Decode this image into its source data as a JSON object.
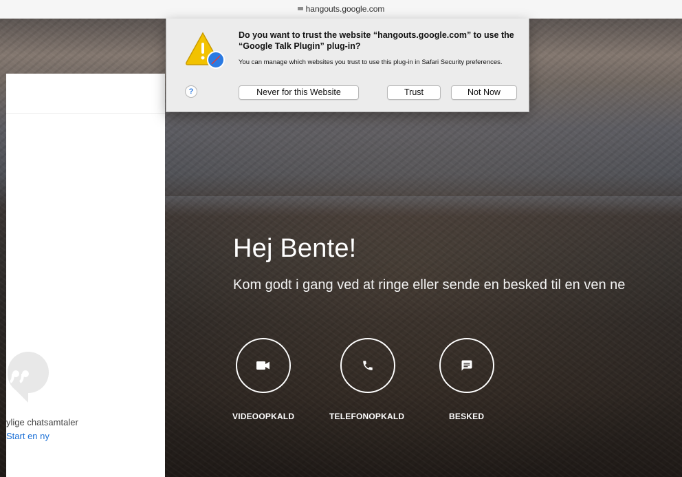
{
  "browser": {
    "url": "hangouts.google.com"
  },
  "dialog": {
    "title": "Do you want to trust the website “hangouts.google.com” to use the “Google Talk Plugin” plug-in?",
    "body": "You can manage which websites you trust to use this plug-in in Safari Security preferences.",
    "help_label": "?",
    "never_label": "Never for this Website",
    "trust_label": "Trust",
    "not_now_label": "Not Now"
  },
  "sidebar": {
    "chat_text": "ylige chatsamtaler",
    "start_link": "Start en ny"
  },
  "hero": {
    "greeting": "Hej Bente!",
    "subtitle": "Kom godt i gang ved at ringe eller sende en besked til en ven ne"
  },
  "actions": [
    {
      "label": "VIDEOOPKALD",
      "icon": "video-camera-icon"
    },
    {
      "label": "TELEFONOPKALD",
      "icon": "phone-icon"
    },
    {
      "label": "BESKED",
      "icon": "message-icon"
    }
  ],
  "colors": {
    "link": "#1a6fd6",
    "warning_yellow": "#f2c200",
    "safari_blue": "#2a7ae2"
  }
}
